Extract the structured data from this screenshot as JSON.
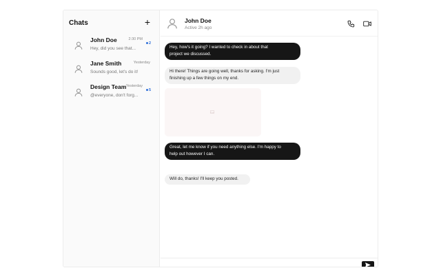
{
  "sidebar": {
    "title": "Chats",
    "new_chat_icon": "plus-icon",
    "chats": [
      {
        "name": "John Doe",
        "time": "2:30 PM",
        "preview": "Hey, did you see that...",
        "unread": "2",
        "avatar_icon": "user-icon"
      },
      {
        "name": "Jane Smith",
        "time": "Yesterday",
        "preview": "Sounds good, let's do it!",
        "unread": "",
        "avatar_icon": "user-icon"
      },
      {
        "name": "Design Team",
        "time": "Yesterday",
        "preview": "@everyone, don't forg...",
        "unread": "5",
        "avatar_icon": "user-icon"
      }
    ]
  },
  "conversation": {
    "contact_name": "John Doe",
    "contact_status": "Active 2h ago",
    "call_icon": "phone-icon",
    "video_icon": "video-icon",
    "messages": [
      {
        "direction": "out",
        "text_lines": [
          "Hey, how's it going? I wanted to check in about that",
          "project we discussed."
        ]
      },
      {
        "direction": "in",
        "text_lines": [
          "Hi there! Things are going well, thanks for asking. I'm just",
          "finishing up a few things on my end."
        ]
      },
      {
        "direction": "in",
        "type": "image",
        "icon": "image-icon"
      },
      {
        "direction": "out",
        "text_lines": [
          "Great, let me know if you need anything else. I'm happy to",
          "help out however I can."
        ]
      },
      {
        "direction": "in",
        "text_lines": [
          "Will do, thanks! I'll keep you posted."
        ]
      }
    ]
  },
  "composer": {
    "placeholder": "",
    "send_icon": "send-icon"
  },
  "colors": {
    "outgoing_bubble": "#161616",
    "incoming_bubble": "#f1f1f1",
    "unread_badge": "#2f6fd8",
    "sidebar_bg": "#fafafa"
  }
}
